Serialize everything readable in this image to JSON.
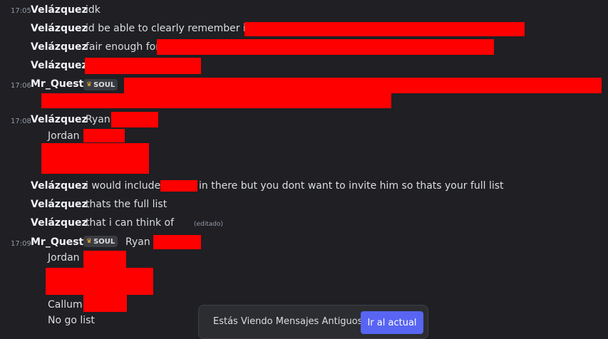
{
  "messages": [
    {
      "time": "17:05",
      "author": "Velázquez",
      "text": "idk"
    },
    {
      "author": "Velázquez",
      "text": "id be able to clearly remember if"
    },
    {
      "author": "Velázquez",
      "text": "fair enough for"
    },
    {
      "author": "Velázquez",
      "text": ""
    },
    {
      "time": "17:06",
      "author": "Mr_Quest",
      "badge": "SOUL"
    },
    {
      "time": "17:08",
      "author": "Velázquez",
      "text": "Ryan",
      "line2": "Jordan"
    },
    {
      "author": "Velázquez",
      "text": "i would include",
      "text_after": "in there but you dont want to invite him so thats your full list"
    },
    {
      "author": "Velázquez",
      "text": "thats the full list"
    },
    {
      "author": "Velázquez",
      "text": "that i can think of",
      "edited": "(editado)"
    },
    {
      "time": "17:09",
      "author": "Mr_Quest",
      "badge": "SOUL",
      "text": "Ryan",
      "line2": "Jordan",
      "line3": "Callum",
      "line4": "No go list"
    }
  ],
  "banner": {
    "text": "Estás Viendo Mensajes Antiguos",
    "button": "Ir al actual"
  },
  "colors": {
    "background": "#1f1f24",
    "redaction": "#ff0000",
    "accent": "#5865f2"
  }
}
